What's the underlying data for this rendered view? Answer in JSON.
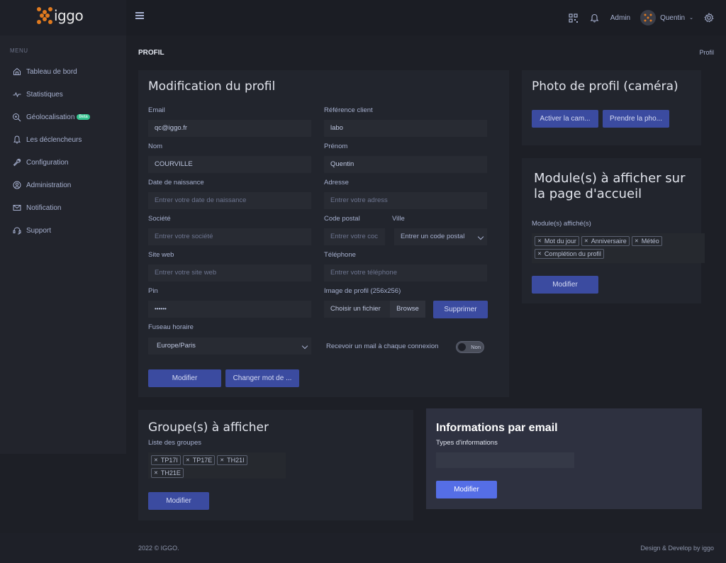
{
  "brand": {
    "logo_text": "iggo"
  },
  "topbar": {
    "admin_label": "Admin",
    "user_name": "Quentin"
  },
  "sidebar": {
    "menu_title": "MENU",
    "items": [
      {
        "label": "Tableau de bord",
        "icon": "home-icon"
      },
      {
        "label": "Statistiques",
        "icon": "activity-icon"
      },
      {
        "label": "Géolocalisation",
        "icon": "search-location-icon",
        "badge": "Beta"
      },
      {
        "label": "Les déclencheurs",
        "icon": "bell-icon"
      },
      {
        "label": "Configuration",
        "icon": "wrench-icon"
      },
      {
        "label": "Administration",
        "icon": "user-circle-icon"
      },
      {
        "label": "Notification",
        "icon": "mail-icon"
      },
      {
        "label": "Support",
        "icon": "headset-icon"
      }
    ]
  },
  "page": {
    "title": "PROFIL",
    "breadcrumb": "Profil"
  },
  "profile_form": {
    "title": "Modification du profil",
    "email": {
      "label": "Email",
      "value": "qc@iggo.fr"
    },
    "reference": {
      "label": "Référence client",
      "value": "labo"
    },
    "nom": {
      "label": "Nom",
      "value": "COURVILLE"
    },
    "prenom": {
      "label": "Prénom",
      "value": "Quentin"
    },
    "birth": {
      "label": "Date de naissance",
      "placeholder": "Entrer votre date de naissance"
    },
    "adresse": {
      "label": "Adresse",
      "placeholder": "Entrer votre adress"
    },
    "societe": {
      "label": "Société",
      "placeholder": "Entrer votre société"
    },
    "code_postal": {
      "label": "Code postal",
      "placeholder": "Entrer votre coc"
    },
    "ville": {
      "label": "Ville",
      "value": "Entrer un code postal"
    },
    "site": {
      "label": "Site web",
      "placeholder": "Entrer votre site web"
    },
    "telephone": {
      "label": "Téléphone",
      "placeholder": "Entrer votre téléphone"
    },
    "pin": {
      "label": "Pin",
      "value": "••••••"
    },
    "image": {
      "label": "Image de profil (256x256)",
      "choose": "Choisir un fichier",
      "browse": "Browse",
      "delete": "Supprimer"
    },
    "timezone": {
      "label": "Fuseau horaire",
      "value": "Europe/Paris"
    },
    "mail_toggle": {
      "label": "Recevoir un mail à chaque connexion",
      "state": "Non"
    },
    "submit": "Modifier",
    "change_password": "Changer mot de ..."
  },
  "camera": {
    "title": "Photo de profil (caméra)",
    "activate": "Activer la cam...",
    "capture": "Prendre la pho..."
  },
  "modules": {
    "title_line1": "Module(s) à afficher sur",
    "title_line2": "la page d'accueil",
    "label": "Module(s) affiché(s)",
    "tags": [
      "Mot du jour",
      "Anniversaire",
      "Météo",
      "Complétion du profil"
    ],
    "submit": "Modifier"
  },
  "groups": {
    "title": "Groupe(s) à afficher",
    "label": "Liste des groupes",
    "tags": [
      "TP17I",
      "TP17E",
      "TH21I",
      "TH21E"
    ],
    "submit": "Modifier"
  },
  "email_info": {
    "title": "Informations par email",
    "label": "Types d'informations",
    "submit": "Modifier"
  },
  "footer": {
    "left": "2022 © IGGO.",
    "right": "Design & Develop by iggo"
  }
}
